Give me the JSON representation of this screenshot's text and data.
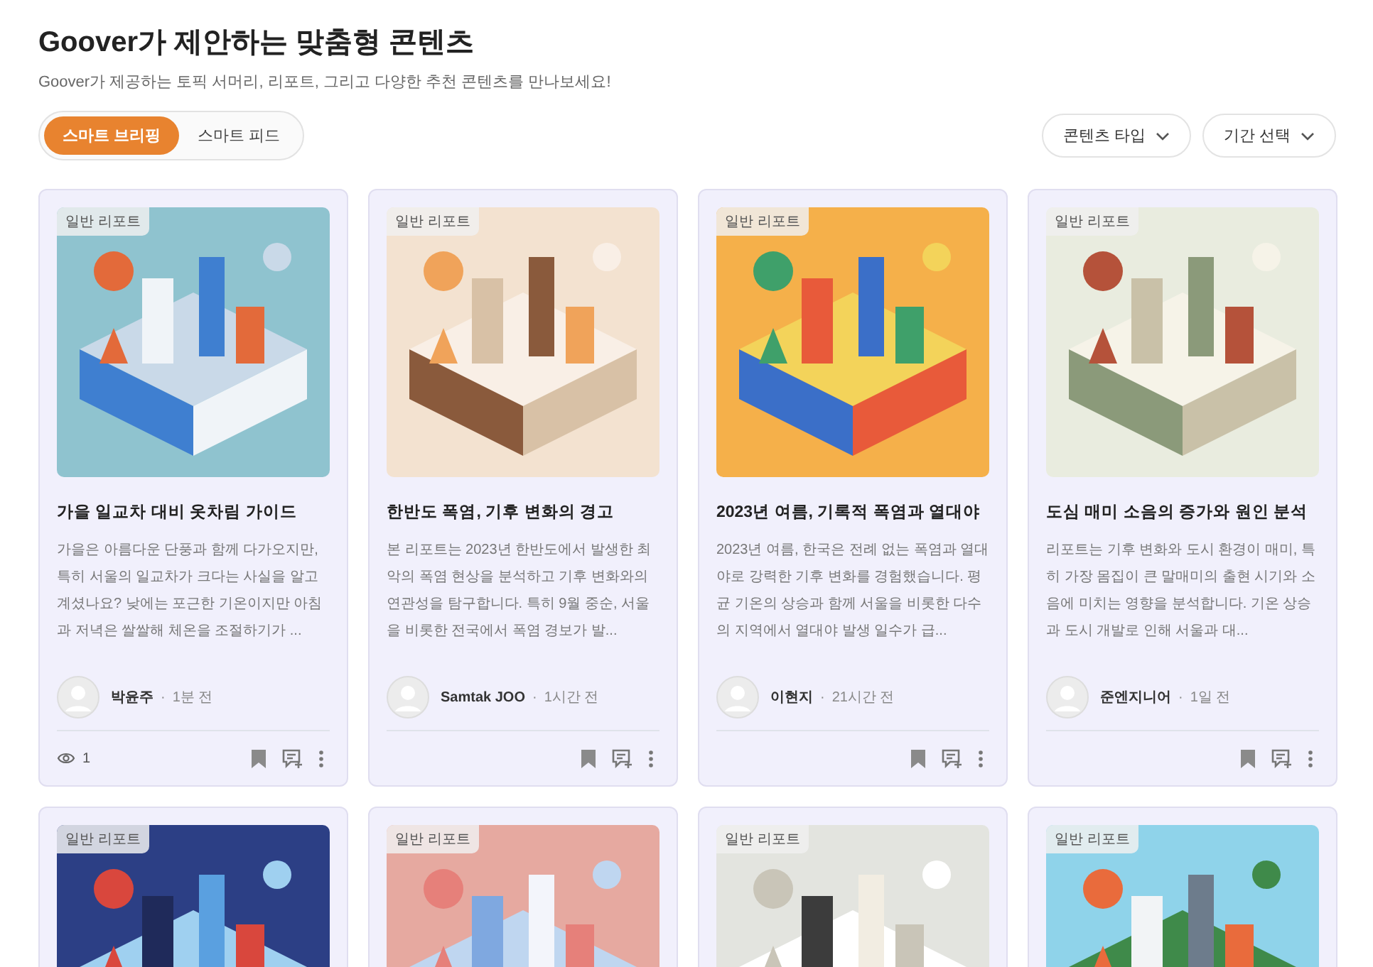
{
  "header": {
    "title": "Goover가 제안하는 맞춤형 콘텐츠",
    "subtitle": "Goover가 제공하는 토픽 서머리, 리포트, 그리고 다양한 추천 콘텐츠를 만나보세요!"
  },
  "tabs": [
    {
      "label": "스마트 브리핑",
      "selected": true
    },
    {
      "label": "스마트 피드",
      "selected": false
    }
  ],
  "filters": [
    {
      "label": "콘텐츠 타입"
    },
    {
      "label": "기간 선택"
    }
  ],
  "cards": [
    {
      "tag": "일반 리포트",
      "title": "가을 일교차 대비 옷차림 가이드",
      "description": "가을은 아름다운 단풍과 함께 다가오지만, 특히 서울의 일교차가 크다는 사실을 알고 계셨나요? 낮에는 포근한 기온이지만 아침과 저녁은 쌀쌀해 체온을 조절하기가 ...",
      "author": "박윤주",
      "separator": "·",
      "time": "1분 전",
      "views": "1"
    },
    {
      "tag": "일반 리포트",
      "title": "한반도 폭염, 기후 변화의 경고",
      "description": "본 리포트는 2023년 한반도에서 발생한 최악의 폭염 현상을 분석하고 기후 변화와의 연관성을 탐구합니다. 특히 9월 중순, 서울을 비롯한 전국에서 폭염 경보가 발...",
      "author": "Samtak JOO",
      "separator": "·",
      "time": "1시간 전"
    },
    {
      "tag": "일반 리포트",
      "title": "2023년 여름, 기록적 폭염과 열대야",
      "description": "2023년 여름, 한국은 전례 없는 폭염과 열대야로 강력한 기후 변화를 경험했습니다. 평균 기온의 상승과 함께 서울을 비롯한 다수의 지역에서 열대야 발생 일수가 급...",
      "author": "이현지",
      "separator": "·",
      "time": "21시간 전"
    },
    {
      "tag": "일반 리포트",
      "title": "도심 매미 소음의 증가와 원인 분석",
      "description": "리포트는 기후 변화와 도시 환경이 매미, 특히 가장 몸집이 큰 말매미의 출현 시기와 소음에 미치는 영향을 분석합니다. 기온 상승과 도시 개발로 인해 서울과 대...",
      "author": "준엔지니어",
      "separator": "·",
      "time": "1일 전"
    },
    {
      "tag": "일반 리포트"
    },
    {
      "tag": "일반 리포트"
    },
    {
      "tag": "일반 리포트"
    },
    {
      "tag": "일반 리포트"
    }
  ]
}
